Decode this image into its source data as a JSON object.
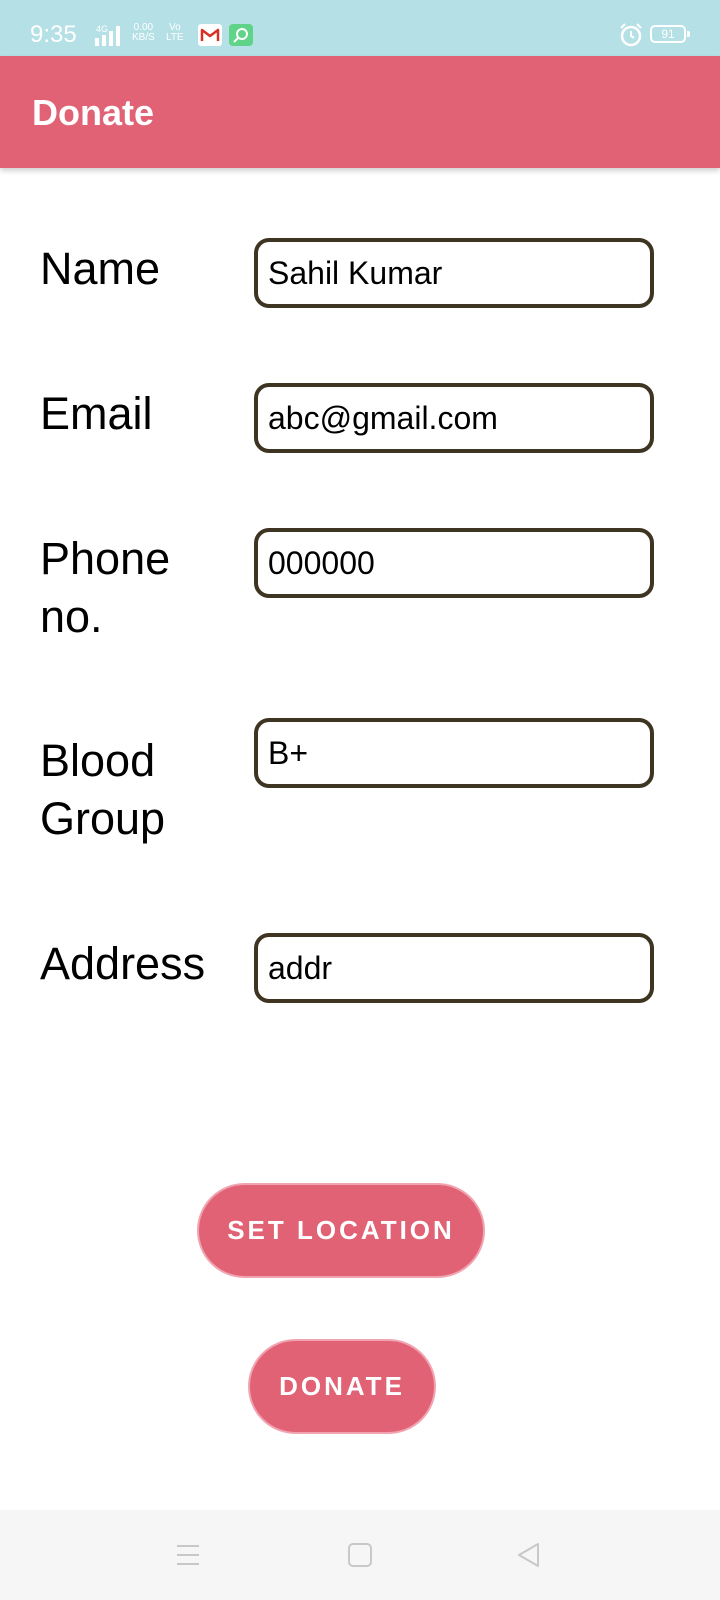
{
  "status_bar": {
    "time": "9:35",
    "network": "4G",
    "speed_value": "0.00",
    "speed_unit": "KB/S",
    "volte_top": "Vo",
    "volte_bottom": "LTE",
    "battery": "91",
    "icons": [
      "signal-icon",
      "gmail-icon",
      "green-app-icon",
      "alarm-icon",
      "battery-icon"
    ]
  },
  "app_bar": {
    "title": "Donate"
  },
  "form": {
    "name": {
      "label": "Name",
      "value": "Sahil Kumar"
    },
    "email": {
      "label": "Email",
      "value": "abc@gmail.com"
    },
    "phone": {
      "label": "Phone no.",
      "value": "000000"
    },
    "blood_group": {
      "label": "Blood Group",
      "value": "B+"
    },
    "address": {
      "label": "Address",
      "value": "addr"
    }
  },
  "buttons": {
    "set_location": "SET LOCATION",
    "donate": "DONATE"
  },
  "colors": {
    "accent": "#e16274",
    "status_bar": "#b4e0e6",
    "input_border": "#3e3422"
  },
  "nav_bar": {
    "icons": [
      "menu-icon",
      "home-icon",
      "back-icon"
    ]
  }
}
